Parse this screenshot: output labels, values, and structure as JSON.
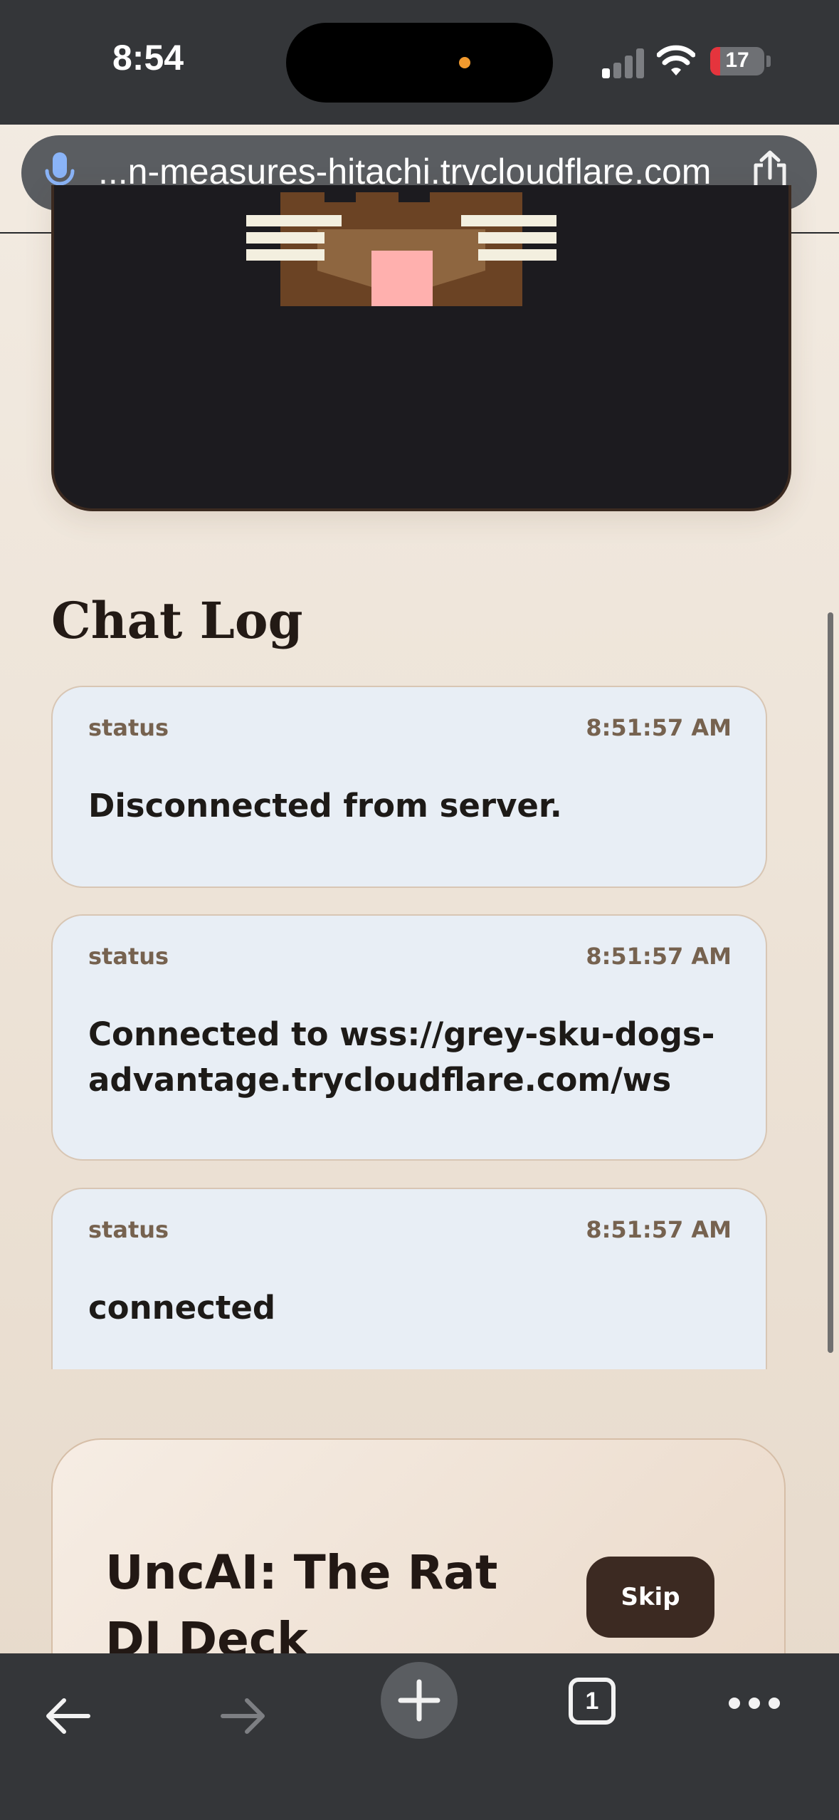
{
  "status_bar": {
    "time": "8:54",
    "battery": "17",
    "icons": [
      "cellular-signal-icon",
      "wifi-icon",
      "battery-icon"
    ]
  },
  "browser": {
    "url": "...n-measures-hitachi.trycloudflare.com",
    "tab_count": "1",
    "icons": [
      "microphone-icon",
      "share-icon",
      "back-arrow-icon",
      "forward-arrow-icon",
      "new-tab-plus-icon",
      "tab-count-icon",
      "more-options-icon"
    ]
  },
  "chat_log": {
    "title": "Chat Log",
    "messages": [
      {
        "type": "status",
        "timestamp": "8:51:57 AM",
        "text": "Disconnected from server."
      },
      {
        "type": "status",
        "timestamp": "8:51:57 AM",
        "text": "Connected to wss://grey-sku-dogs-advantage.trycloudflare.com/ws"
      },
      {
        "type": "status",
        "timestamp": "8:51:57 AM",
        "text": "connected"
      }
    ]
  },
  "deck": {
    "title": "UncAI: The Rat DJ Deck",
    "skip_label": "Skip"
  },
  "colors": {
    "page_background": "#efe6dc",
    "message_background": "#e8eef5",
    "game_background": "#1c1b1f",
    "skip_button": "#3c2a22",
    "browser_chrome": "#343639"
  }
}
